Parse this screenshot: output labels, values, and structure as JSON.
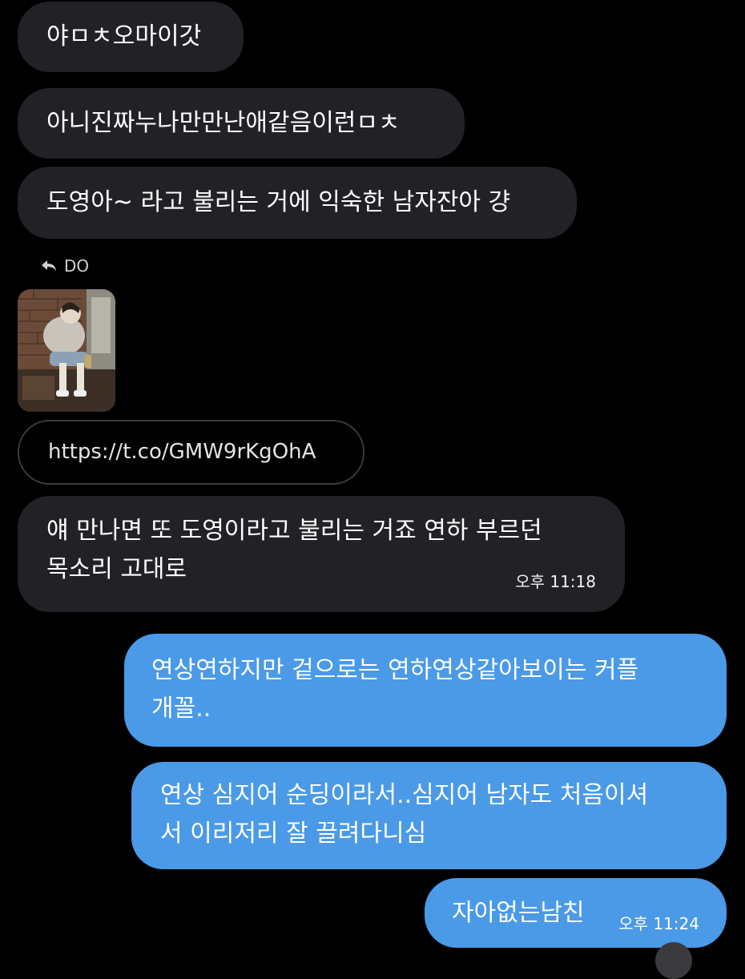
{
  "conversation": {
    "received": [
      {
        "text": "야ㅁㅊ오마이갓"
      },
      {
        "text": "아니진짜누나만만난애같음이런ㅁㅊ"
      },
      {
        "text": "도영아~ 라고 불리는 거에 익숙한 남자잔아 걍"
      }
    ],
    "reply_context": {
      "icon": "reply-arrow-icon",
      "name": "DO"
    },
    "link": {
      "url": "https://t.co/GMW9rKgOhA"
    },
    "received_with_time": {
      "line1": "얘 만나면 또 도영이라고 불리는 거죠 연하 부르던",
      "line2": "목소리 고대로",
      "time": "오후 11:18"
    },
    "sent": [
      {
        "line1": "연상연하지만 겉으로는 연하연상같아보이는 커플",
        "line2": "개꼴.."
      },
      {
        "line1": "연상 심지어 순딩이라서..심지어 남자도 처음이셔",
        "line2": "서 이리저리 잘 끌려다니심"
      }
    ],
    "sent_last": {
      "text": "자아없는남친",
      "time": "오후 11:24"
    }
  },
  "colors": {
    "background": "#000000",
    "received_bubble": "#222226",
    "sent_bubble": "#4a9ae8"
  }
}
